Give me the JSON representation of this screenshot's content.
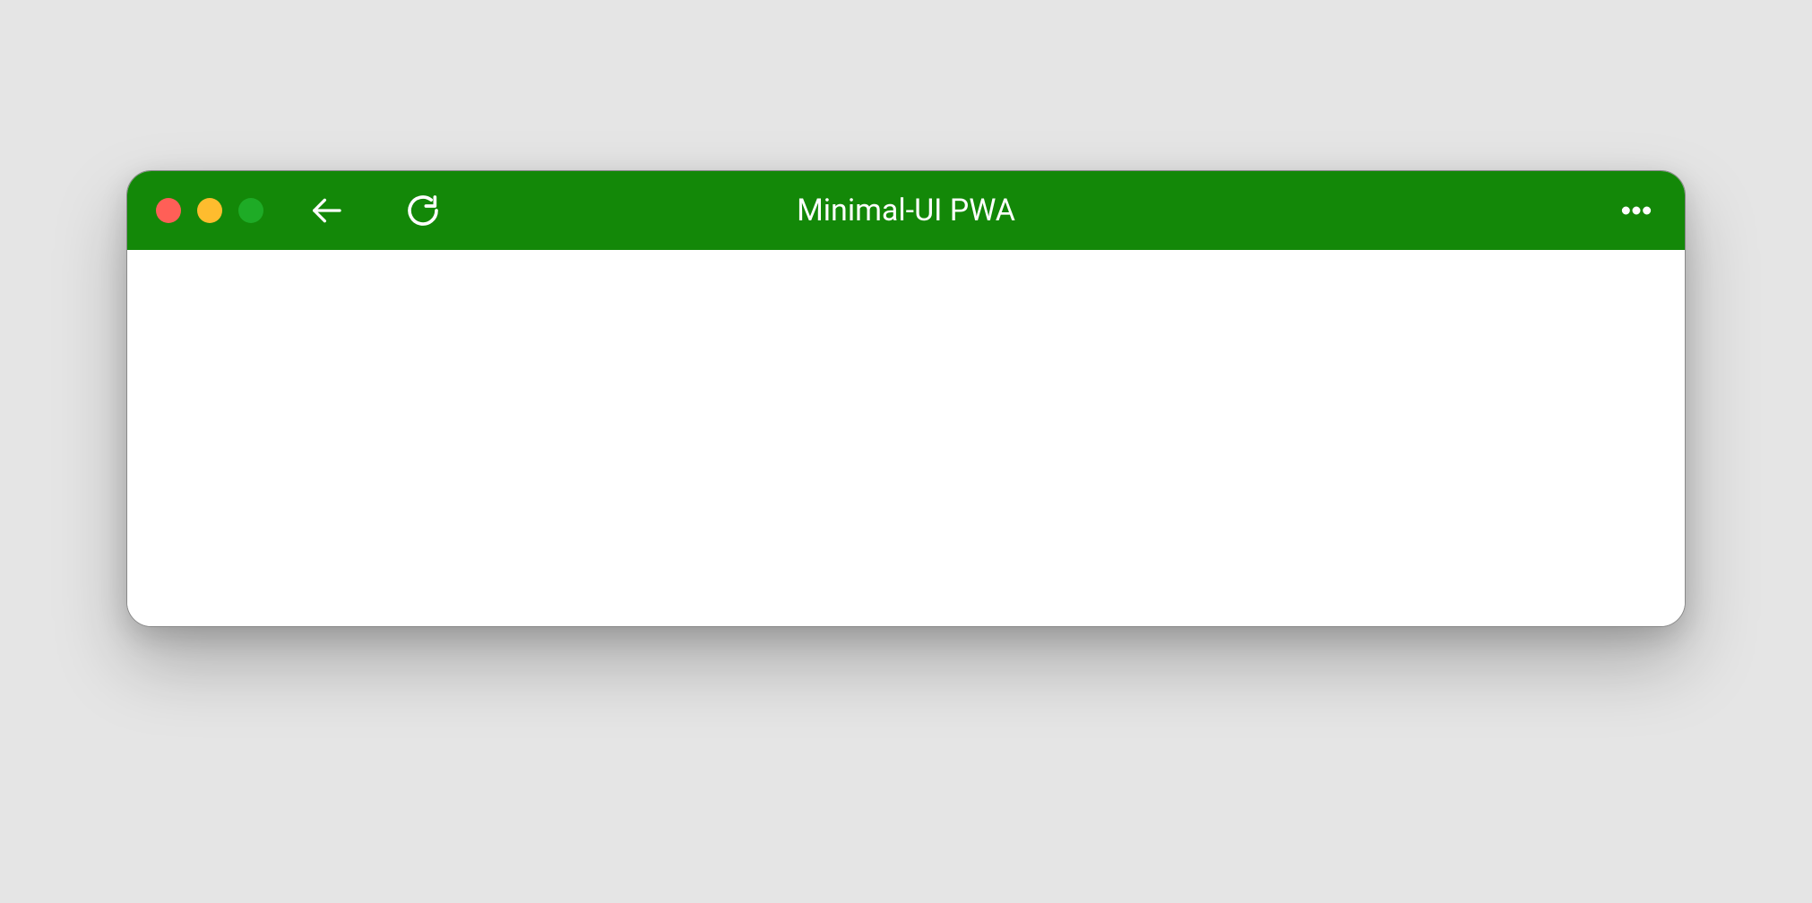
{
  "window": {
    "title": "Minimal-UI PWA",
    "titlebar_color": "#138808",
    "traffic_lights": {
      "close": "#ff5f57",
      "minimize": "#febc2e",
      "maximize": "#28c840"
    }
  }
}
